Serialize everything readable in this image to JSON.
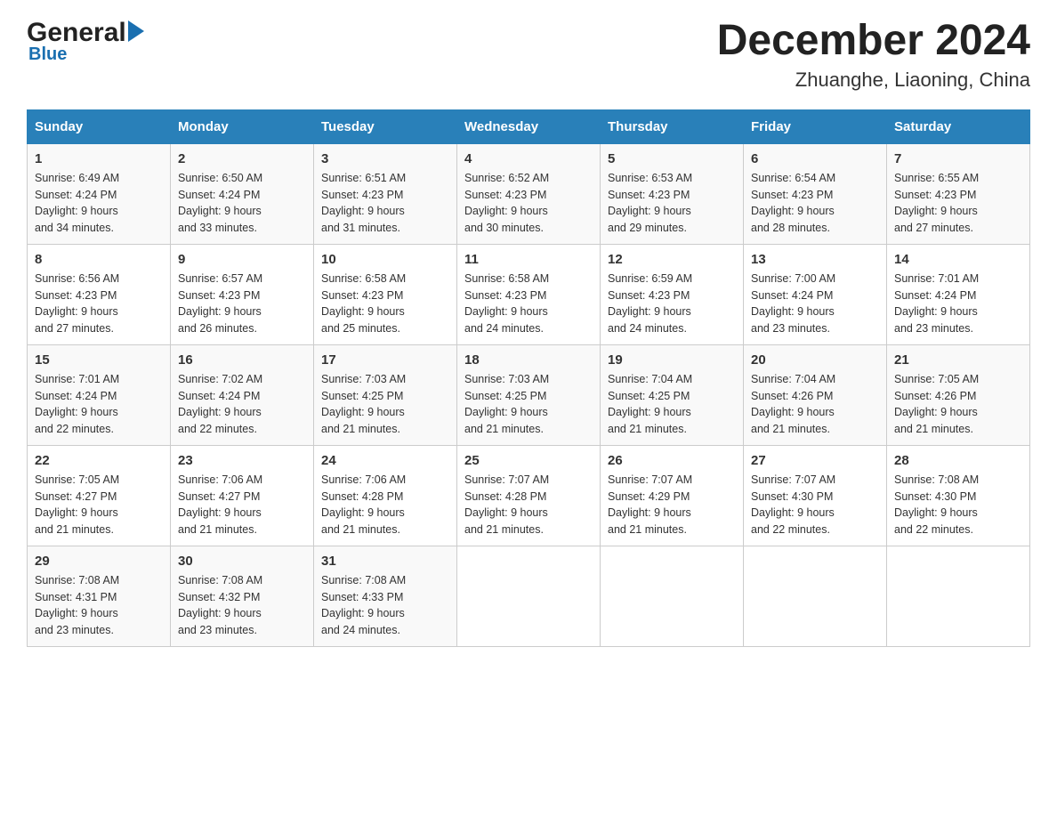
{
  "logo": {
    "general": "General",
    "blue": "Blue"
  },
  "title": "December 2024",
  "subtitle": "Zhuanghe, Liaoning, China",
  "days_of_week": [
    "Sunday",
    "Monday",
    "Tuesday",
    "Wednesday",
    "Thursday",
    "Friday",
    "Saturday"
  ],
  "weeks": [
    [
      {
        "day": "1",
        "sunrise": "6:49 AM",
        "sunset": "4:24 PM",
        "daylight": "9 hours and 34 minutes."
      },
      {
        "day": "2",
        "sunrise": "6:50 AM",
        "sunset": "4:24 PM",
        "daylight": "9 hours and 33 minutes."
      },
      {
        "day": "3",
        "sunrise": "6:51 AM",
        "sunset": "4:23 PM",
        "daylight": "9 hours and 31 minutes."
      },
      {
        "day": "4",
        "sunrise": "6:52 AM",
        "sunset": "4:23 PM",
        "daylight": "9 hours and 30 minutes."
      },
      {
        "day": "5",
        "sunrise": "6:53 AM",
        "sunset": "4:23 PM",
        "daylight": "9 hours and 29 minutes."
      },
      {
        "day": "6",
        "sunrise": "6:54 AM",
        "sunset": "4:23 PM",
        "daylight": "9 hours and 28 minutes."
      },
      {
        "day": "7",
        "sunrise": "6:55 AM",
        "sunset": "4:23 PM",
        "daylight": "9 hours and 27 minutes."
      }
    ],
    [
      {
        "day": "8",
        "sunrise": "6:56 AM",
        "sunset": "4:23 PM",
        "daylight": "9 hours and 27 minutes."
      },
      {
        "day": "9",
        "sunrise": "6:57 AM",
        "sunset": "4:23 PM",
        "daylight": "9 hours and 26 minutes."
      },
      {
        "day": "10",
        "sunrise": "6:58 AM",
        "sunset": "4:23 PM",
        "daylight": "9 hours and 25 minutes."
      },
      {
        "day": "11",
        "sunrise": "6:58 AM",
        "sunset": "4:23 PM",
        "daylight": "9 hours and 24 minutes."
      },
      {
        "day": "12",
        "sunrise": "6:59 AM",
        "sunset": "4:23 PM",
        "daylight": "9 hours and 24 minutes."
      },
      {
        "day": "13",
        "sunrise": "7:00 AM",
        "sunset": "4:24 PM",
        "daylight": "9 hours and 23 minutes."
      },
      {
        "day": "14",
        "sunrise": "7:01 AM",
        "sunset": "4:24 PM",
        "daylight": "9 hours and 23 minutes."
      }
    ],
    [
      {
        "day": "15",
        "sunrise": "7:01 AM",
        "sunset": "4:24 PM",
        "daylight": "9 hours and 22 minutes."
      },
      {
        "day": "16",
        "sunrise": "7:02 AM",
        "sunset": "4:24 PM",
        "daylight": "9 hours and 22 minutes."
      },
      {
        "day": "17",
        "sunrise": "7:03 AM",
        "sunset": "4:25 PM",
        "daylight": "9 hours and 21 minutes."
      },
      {
        "day": "18",
        "sunrise": "7:03 AM",
        "sunset": "4:25 PM",
        "daylight": "9 hours and 21 minutes."
      },
      {
        "day": "19",
        "sunrise": "7:04 AM",
        "sunset": "4:25 PM",
        "daylight": "9 hours and 21 minutes."
      },
      {
        "day": "20",
        "sunrise": "7:04 AM",
        "sunset": "4:26 PM",
        "daylight": "9 hours and 21 minutes."
      },
      {
        "day": "21",
        "sunrise": "7:05 AM",
        "sunset": "4:26 PM",
        "daylight": "9 hours and 21 minutes."
      }
    ],
    [
      {
        "day": "22",
        "sunrise": "7:05 AM",
        "sunset": "4:27 PM",
        "daylight": "9 hours and 21 minutes."
      },
      {
        "day": "23",
        "sunrise": "7:06 AM",
        "sunset": "4:27 PM",
        "daylight": "9 hours and 21 minutes."
      },
      {
        "day": "24",
        "sunrise": "7:06 AM",
        "sunset": "4:28 PM",
        "daylight": "9 hours and 21 minutes."
      },
      {
        "day": "25",
        "sunrise": "7:07 AM",
        "sunset": "4:28 PM",
        "daylight": "9 hours and 21 minutes."
      },
      {
        "day": "26",
        "sunrise": "7:07 AM",
        "sunset": "4:29 PM",
        "daylight": "9 hours and 21 minutes."
      },
      {
        "day": "27",
        "sunrise": "7:07 AM",
        "sunset": "4:30 PM",
        "daylight": "9 hours and 22 minutes."
      },
      {
        "day": "28",
        "sunrise": "7:08 AM",
        "sunset": "4:30 PM",
        "daylight": "9 hours and 22 minutes."
      }
    ],
    [
      {
        "day": "29",
        "sunrise": "7:08 AM",
        "sunset": "4:31 PM",
        "daylight": "9 hours and 23 minutes."
      },
      {
        "day": "30",
        "sunrise": "7:08 AM",
        "sunset": "4:32 PM",
        "daylight": "9 hours and 23 minutes."
      },
      {
        "day": "31",
        "sunrise": "7:08 AM",
        "sunset": "4:33 PM",
        "daylight": "9 hours and 24 minutes."
      },
      null,
      null,
      null,
      null
    ]
  ],
  "labels": {
    "sunrise": "Sunrise:",
    "sunset": "Sunset:",
    "daylight": "Daylight:"
  }
}
